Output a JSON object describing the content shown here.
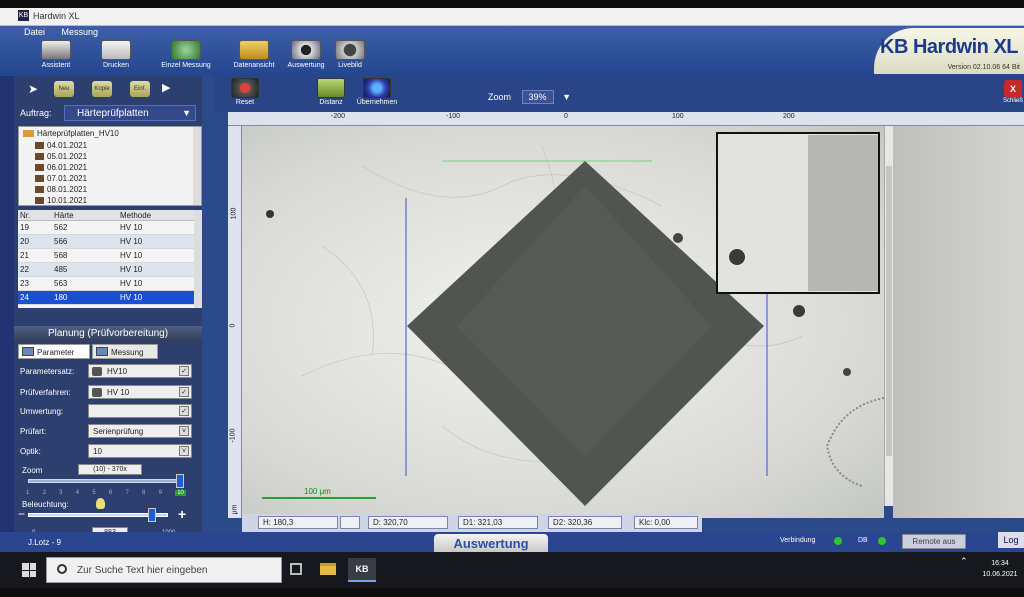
{
  "window": {
    "title": "Hardwin XL"
  },
  "menu": [
    "Datei",
    "Messung"
  ],
  "toolbar": [
    {
      "label": "Assistent",
      "icon": "assistant-icon"
    },
    {
      "label": "Drucken",
      "icon": "printer-icon"
    },
    {
      "label": "Einzel Messung",
      "icon": "single-measure-icon"
    },
    {
      "label": "Datenansicht",
      "icon": "data-view-icon"
    },
    {
      "label": "Auswertung",
      "icon": "evaluation-icon"
    },
    {
      "label": "Livebild",
      "icon": "camera-icon"
    }
  ],
  "brand": {
    "logo": "KB Hardwin XL",
    "version": "Version 02.10.06   64 Bit"
  },
  "left_nav": [
    "Neu",
    "Kopie",
    "Einf."
  ],
  "auftrag": {
    "label": "Auftrag:",
    "value": "Härteprüfplatten"
  },
  "tree": {
    "root": "Härteprüfplatten_HV10",
    "dates": [
      "04.01.2021",
      "05.01.2021",
      "06.01.2021",
      "07.01.2021",
      "08.01.2021",
      "10.01.2021"
    ]
  },
  "results": {
    "headers": [
      "Nr.",
      "Härte",
      "Methode"
    ],
    "rows": [
      [
        "19",
        "562",
        "HV 10"
      ],
      [
        "20",
        "566",
        "HV 10"
      ],
      [
        "21",
        "568",
        "HV 10"
      ],
      [
        "22",
        "485",
        "HV 10"
      ],
      [
        "23",
        "563",
        "HV 10"
      ],
      [
        "24",
        "180",
        "HV 10"
      ]
    ],
    "selected_row": 5
  },
  "planung": {
    "title": "Planung (Prüfvorbereitung)",
    "tabs": [
      "Parameter",
      "Messung"
    ],
    "fields": [
      {
        "label": "Parametersatz:",
        "value": "HV10"
      },
      {
        "label": "Prüfverfahren:",
        "value": "HV 10"
      },
      {
        "label": "Umwertung:",
        "value": ""
      },
      {
        "label": "Prüfart:",
        "value": "Serienprüfung"
      },
      {
        "label": "Optik:",
        "value": "10"
      }
    ],
    "zoom": {
      "label": "Zoom",
      "value": "(10) - 370x",
      "ticks": [
        "1",
        "2",
        "3",
        "4",
        "5",
        "6",
        "7",
        "8",
        "9",
        "10"
      ],
      "active": "10"
    },
    "beleuchtung": {
      "label": "Beleuchtung:",
      "min": "0",
      "value": "883",
      "max": "1000",
      "level": 0.883
    }
  },
  "view_toolbar": [
    {
      "label": "Reset",
      "icon": "reset-icon"
    },
    {
      "label": "Distanz",
      "icon": "distance-icon"
    },
    {
      "label": "Übernehmen",
      "icon": "accept-icon"
    }
  ],
  "zoom_ctl": {
    "label": "Zoom",
    "value": "39%"
  },
  "close": {
    "label": "Schließ"
  },
  "ruler_x": [
    "-200",
    "-100",
    "0",
    "100",
    "200"
  ],
  "ruler_y": [
    "100",
    "0",
    "-100"
  ],
  "ruler_unit": "μm",
  "scale_bar": "100 μm",
  "measurements": {
    "H": "H: 180,3",
    "D": "D: 320,70",
    "D1": "D1: 321,03",
    "D2": "D2: 320,36",
    "Klc": "Klc: 0,00"
  },
  "footer": {
    "user": "J.Lotz - 9",
    "tab": "Auswertung",
    "verbindung": "Verbindung",
    "db": "DB",
    "remote": "Remote aus",
    "log": "Log"
  },
  "taskbar": {
    "search_placeholder": "Zur Suche Text hier eingeben",
    "app": "KB",
    "time": "16:34",
    "date": "10.06.2021"
  },
  "colors": {
    "accent": "#2a4a8a",
    "selection": "#1a4fd1",
    "status_ok": "#2ec42e"
  }
}
